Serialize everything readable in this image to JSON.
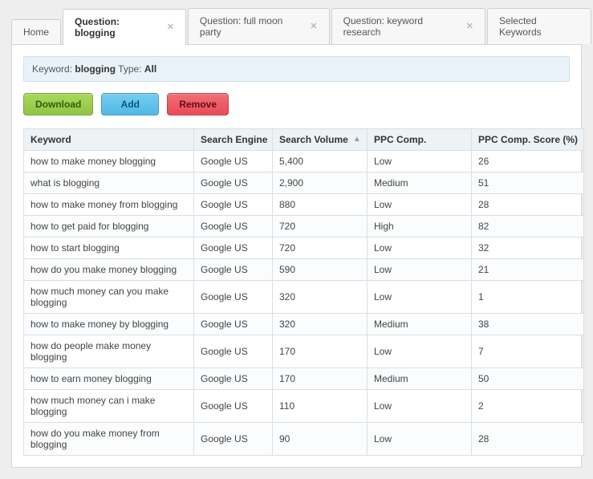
{
  "tabs": [
    {
      "label": "Home",
      "closable": false,
      "active": false
    },
    {
      "label": "Question: blogging",
      "closable": true,
      "active": true
    },
    {
      "label": "Question: full moon party",
      "closable": true,
      "active": false
    },
    {
      "label": "Question: keyword research",
      "closable": true,
      "active": false
    },
    {
      "label": "Selected Keywords",
      "closable": false,
      "active": false
    }
  ],
  "info": {
    "keyword_label": "Keyword:",
    "keyword_value": "blogging",
    "type_label": "Type:",
    "type_value": "All"
  },
  "toolbar": {
    "download": "Download",
    "add": "Add",
    "remove": "Remove"
  },
  "columns": {
    "keyword": "Keyword",
    "engine": "Search Engine",
    "volume": "Search Volume",
    "ppc": "PPC Comp.",
    "score": "PPC Comp. Score (%)"
  },
  "sort": {
    "column": "volume",
    "dir": "asc"
  },
  "rows": [
    {
      "keyword": "how to make money blogging",
      "engine": "Google US",
      "volume": "5,400",
      "ppc": "Low",
      "score": "26"
    },
    {
      "keyword": "what is blogging",
      "engine": "Google US",
      "volume": "2,900",
      "ppc": "Medium",
      "score": "51"
    },
    {
      "keyword": "how to make money from blogging",
      "engine": "Google US",
      "volume": "880",
      "ppc": "Low",
      "score": "28"
    },
    {
      "keyword": "how to get paid for blogging",
      "engine": "Google US",
      "volume": "720",
      "ppc": "High",
      "score": "82"
    },
    {
      "keyword": "how to start blogging",
      "engine": "Google US",
      "volume": "720",
      "ppc": "Low",
      "score": "32"
    },
    {
      "keyword": "how do you make money blogging",
      "engine": "Google US",
      "volume": "590",
      "ppc": "Low",
      "score": "21"
    },
    {
      "keyword": "how much money can you make blogging",
      "engine": "Google US",
      "volume": "320",
      "ppc": "Low",
      "score": "1"
    },
    {
      "keyword": "how to make money by blogging",
      "engine": "Google US",
      "volume": "320",
      "ppc": "Medium",
      "score": "38"
    },
    {
      "keyword": "how do people make money blogging",
      "engine": "Google US",
      "volume": "170",
      "ppc": "Low",
      "score": "7"
    },
    {
      "keyword": "how to earn money blogging",
      "engine": "Google US",
      "volume": "170",
      "ppc": "Medium",
      "score": "50"
    },
    {
      "keyword": "how much money can i make blogging",
      "engine": "Google US",
      "volume": "110",
      "ppc": "Low",
      "score": "2"
    },
    {
      "keyword": "how do you make money from blogging",
      "engine": "Google US",
      "volume": "90",
      "ppc": "Low",
      "score": "28"
    }
  ]
}
